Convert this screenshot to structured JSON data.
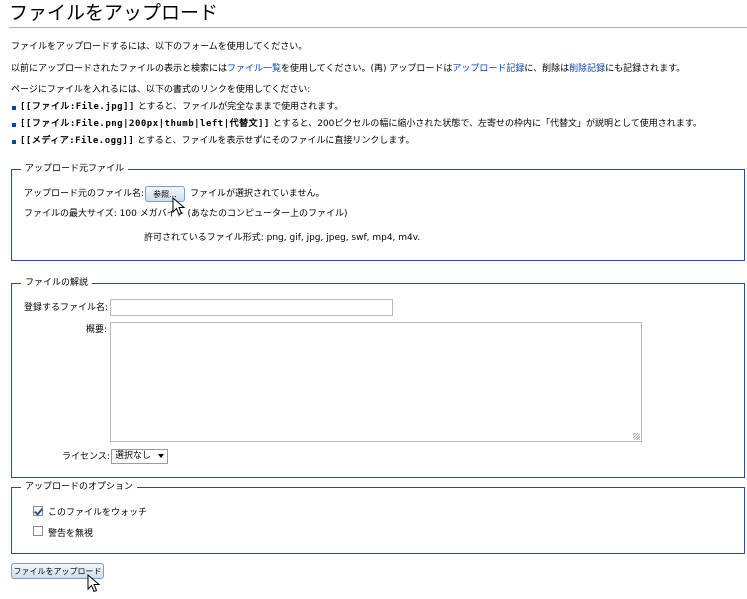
{
  "page": {
    "title": "ファイルをアップロード",
    "intro": "ファイルをアップロードするには、以下のフォームを使用してください。",
    "line2": {
      "before": "以前にアップロードされたファイルの表示と検索には",
      "link1": "ファイル一覧",
      "middle1": "を使用してください。(再) アップロードは",
      "link2": "アップロード記録",
      "middle2": "に、削除は",
      "link3": "削除記録",
      "after": "にも記録されます。"
    },
    "line3": "ページにファイルを入れるには、以下の書式のリンクを使用してください:",
    "bullets": [
      {
        "code": "[[ファイル:File.jpg]]",
        "text": " とすると、ファイルが完全なままで使用されます。"
      },
      {
        "code": "[[ファイル:File.png|200px|thumb|left|代替文]]",
        "text": " とすると、200ピクセルの幅に縮小された状態で、左寄せの枠内に「代替文」が説明として使用されます。"
      },
      {
        "code": "[[メディア:File.ogg]]",
        "text": " とすると、ファイルを表示せずにそのファイルに直接リンクします。"
      }
    ]
  },
  "source": {
    "legend": "アップロード元ファイル",
    "file_label": "アップロード元のファイル名:",
    "browse_button": "参照...",
    "no_file": "ファイルが選択されていません。",
    "max_size": "ファイルの最大サイズ: 100 メガバイト (あなたのコンピューター上のファイル)",
    "allowed_types": "許可されているファイル形式: png, gif, jpg, jpeg, swf, mp4, m4v."
  },
  "description": {
    "legend": "ファイルの解説",
    "dest_label": "登録するファイル名:",
    "dest_value": "",
    "summary_label": "概要:",
    "summary_value": "",
    "license_label": "ライセンス:",
    "license_selected": "選択なし"
  },
  "options": {
    "legend": "アップロードのオプション",
    "watch_label": "このファイルをウォッチ",
    "watch_checked": true,
    "ignore_warnings_label": "警告を無視",
    "ignore_warnings_checked": false
  },
  "submit": {
    "label": "ファイルをアップロード"
  },
  "colors": {
    "link": "#0645ad",
    "fieldset_border": "#2a4b8d"
  }
}
